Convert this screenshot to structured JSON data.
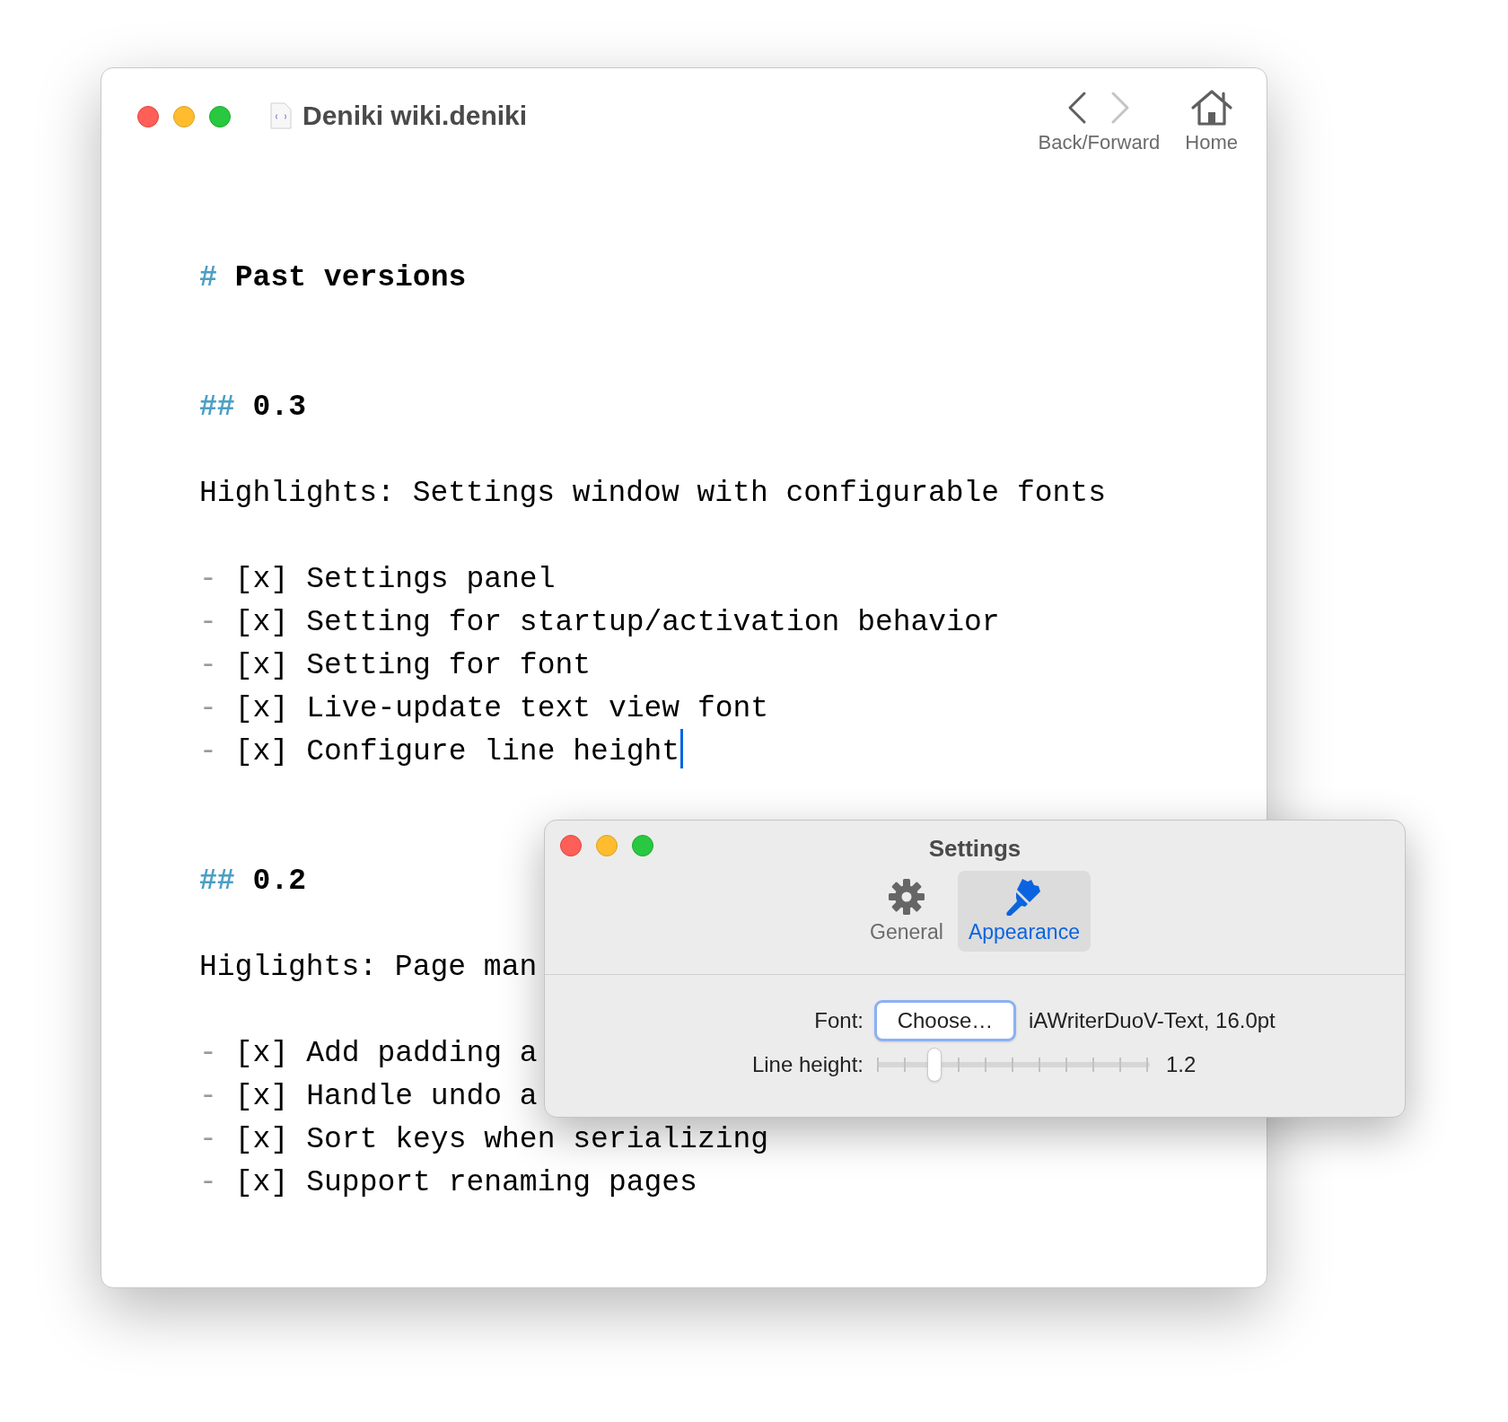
{
  "window": {
    "title": "Deniki wiki.deniki",
    "toolbar": [
      {
        "kind": "backforward",
        "label": "Back/Forward",
        "back_disabled": false,
        "forward_disabled": true
      },
      {
        "kind": "home",
        "label": "Home"
      }
    ]
  },
  "document": [
    {
      "kind": "heading",
      "marker": "#",
      "text": "Past versions"
    },
    {
      "kind": "heading",
      "marker": "##",
      "text": "0.3"
    },
    {
      "kind": "paragraph",
      "text": "Highlights: Settings window with configurable fonts"
    },
    {
      "kind": "task",
      "bullet": "-",
      "box": "[x]",
      "text": "Settings panel",
      "cursor": false
    },
    {
      "kind": "task",
      "bullet": "-",
      "box": "[x]",
      "text": "Setting for startup/activation behavior",
      "cursor": false
    },
    {
      "kind": "task",
      "bullet": "-",
      "box": "[x]",
      "text": "Setting for font",
      "cursor": false
    },
    {
      "kind": "task",
      "bullet": "-",
      "box": "[x]",
      "text": "Live-update text view font",
      "cursor": false
    },
    {
      "kind": "task",
      "bullet": "-",
      "box": "[x]",
      "text": "Configure line height",
      "cursor": true
    },
    {
      "kind": "heading",
      "marker": "##",
      "text": "0.2"
    },
    {
      "kind": "paragraph",
      "text": "Higlights: Page man"
    },
    {
      "kind": "task",
      "bullet": "-",
      "box": "[x]",
      "text": "Add padding a",
      "cursor": false
    },
    {
      "kind": "task",
      "bullet": "-",
      "box": "[x]",
      "text": "Handle undo a",
      "cursor": false
    },
    {
      "kind": "task",
      "bullet": "-",
      "box": "[x]",
      "text": "Sort keys when serializing",
      "cursor": false
    },
    {
      "kind": "task",
      "bullet": "-",
      "box": "[x]",
      "text": "Support renaming pages",
      "cursor": false
    }
  ],
  "settings": {
    "title": "Settings",
    "tabs": [
      {
        "kind": "gear",
        "label": "General",
        "selected": false
      },
      {
        "kind": "brush",
        "label": "Appearance",
        "selected": true
      }
    ],
    "font": {
      "label": "Font:",
      "button": "Choose…",
      "value": "iAWriterDuoV-Text, 16.0pt"
    },
    "line_height": {
      "label": "Line height:",
      "level": 0.21,
      "reading": "1.2"
    }
  }
}
